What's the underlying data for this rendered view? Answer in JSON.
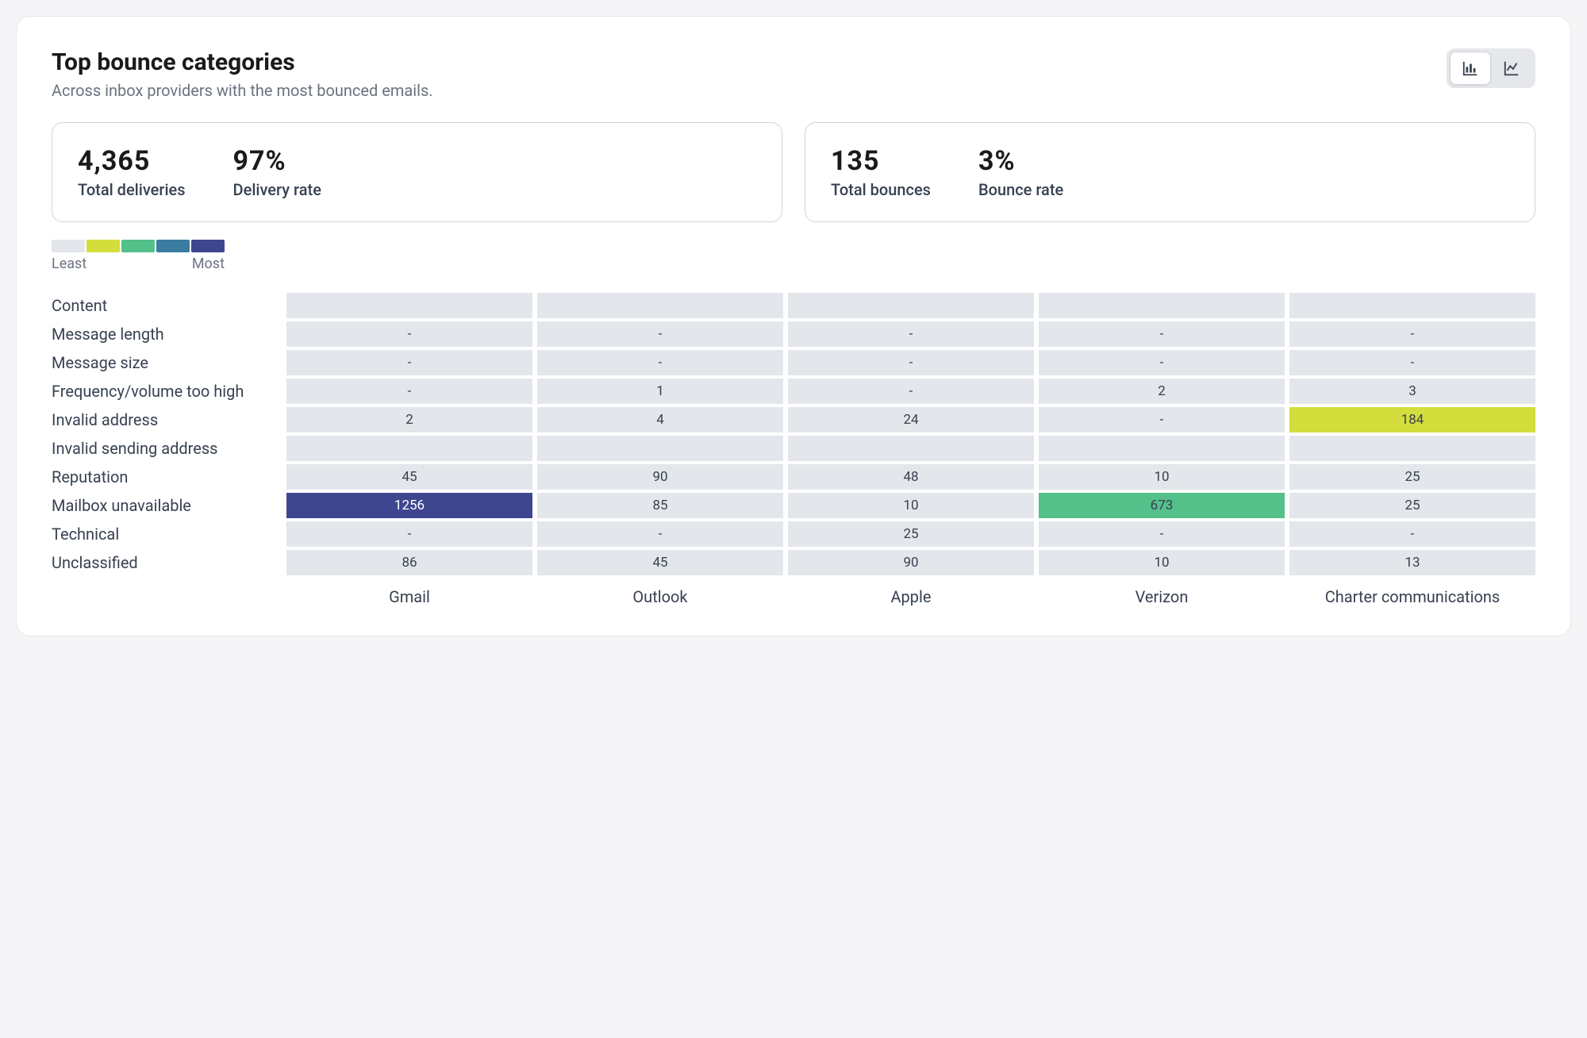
{
  "header": {
    "title": "Top bounce categories",
    "subtitle": "Across inbox providers with the most bounced emails."
  },
  "stats": {
    "deliveries": {
      "value": "4,365",
      "label": "Total deliveries"
    },
    "delivery_rate": {
      "value": "97%",
      "label": "Delivery rate"
    },
    "bounces": {
      "value": "135",
      "label": "Total bounces"
    },
    "bounce_rate": {
      "value": "3%",
      "label": "Bounce rate"
    }
  },
  "legend": {
    "least": "Least",
    "most": "Most",
    "colors": [
      "#e3e6ea",
      "#d3dd3c",
      "#54c08a",
      "#3b7ca0",
      "#3e468f"
    ]
  },
  "chart_data": {
    "type": "heatmap",
    "title": "Top bounce categories",
    "xlabel": "",
    "ylabel": "",
    "columns": [
      "Gmail",
      "Outlook",
      "Apple",
      "Verizon",
      "Charter communications"
    ],
    "rows": [
      {
        "label": "Content",
        "values": [
          null,
          null,
          null,
          null,
          null
        ]
      },
      {
        "label": "Message length",
        "values": [
          "-",
          "-",
          "-",
          "-",
          "-"
        ]
      },
      {
        "label": "Message size",
        "values": [
          "-",
          "-",
          "-",
          "-",
          "-"
        ]
      },
      {
        "label": "Frequency/volume too high",
        "values": [
          "-",
          1,
          "-",
          2,
          3
        ]
      },
      {
        "label": "Invalid address",
        "values": [
          2,
          4,
          24,
          "-",
          184
        ]
      },
      {
        "label": "Invalid sending address",
        "values": [
          null,
          null,
          null,
          null,
          null
        ]
      },
      {
        "label": "Reputation",
        "values": [
          45,
          90,
          48,
          10,
          25
        ]
      },
      {
        "label": "Mailbox unavailable",
        "values": [
          1256,
          85,
          10,
          673,
          25
        ]
      },
      {
        "label": "Technical",
        "values": [
          "-",
          "-",
          25,
          "-",
          "-"
        ]
      },
      {
        "label": "Unclassified",
        "values": [
          86,
          45,
          90,
          10,
          13
        ]
      }
    ],
    "color_scale": {
      "default": "#e3e6ea",
      "breakpoints": [
        {
          "min": 100,
          "max": 300,
          "color": "#d3dd3c"
        },
        {
          "min": 300,
          "max": 800,
          "color": "#54c08a"
        },
        {
          "min": 800,
          "max": 1100,
          "color": "#3b7ca0"
        },
        {
          "min": 1100,
          "max": 100000,
          "color": "#3e468f",
          "light_text": true
        }
      ]
    }
  }
}
